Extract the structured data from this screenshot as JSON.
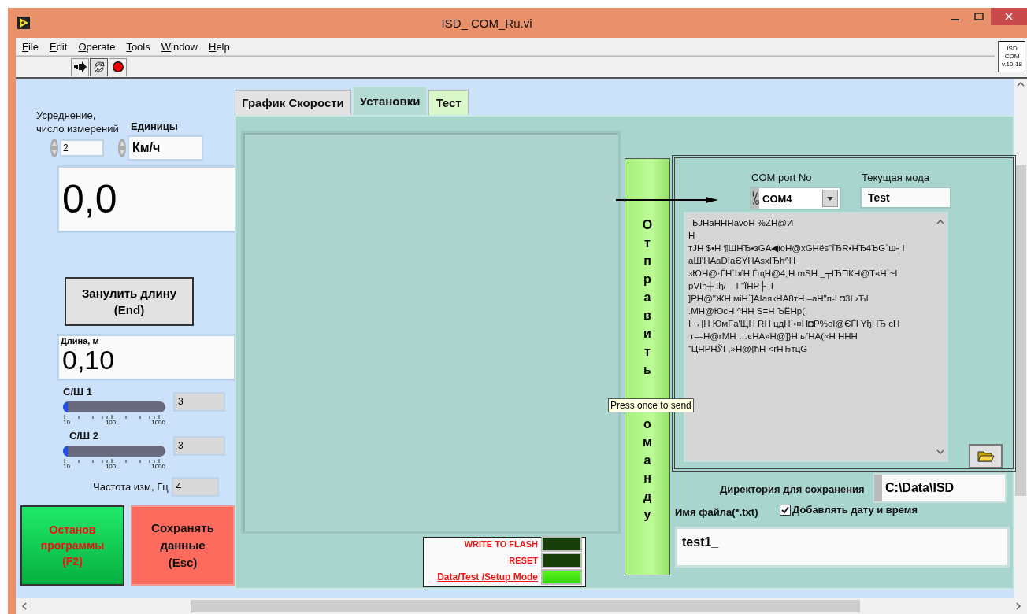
{
  "window": {
    "title": "ISD_ COM_Ru.vi"
  },
  "menu": [
    "File",
    "Edit",
    "Operate",
    "Tools",
    "Window",
    "Help"
  ],
  "vi_icon": {
    "lines": [
      "ISD",
      "COM",
      "v.10-18"
    ]
  },
  "left_panel": {
    "averaging": {
      "label": "Усреднение,\nчисло измерений",
      "value": "2"
    },
    "units": {
      "label": "Единицы",
      "value": "Км/ч"
    },
    "speed": {
      "value": "0,0"
    },
    "zero_button": {
      "label": "Занулить длину\n(End)"
    },
    "length": {
      "label": "Длина, м",
      "value": "0,10"
    },
    "snr": [
      {
        "label": "С/Ш 1",
        "level": 0.02,
        "ticks": [
          "10",
          "100",
          "1000"
        ],
        "value": "3"
      },
      {
        "label": "С/Ш 2",
        "level": 0.02,
        "ticks": [
          "10",
          "100",
          "1000"
        ],
        "value": "3"
      }
    ],
    "frequency": {
      "label": "Частота изм, Гц",
      "value": "4"
    },
    "stop_button": {
      "label": "Останов\nпрограммы\n(F2)"
    },
    "save_button": {
      "label": "Сохранять\nданные\n(Esc)"
    }
  },
  "tabs": [
    {
      "label": "График Скорости",
      "selected": false,
      "color": "#e2e2e2"
    },
    {
      "label": "Установки",
      "selected": true,
      "color": "#b4dbd4"
    },
    {
      "label": "Тест",
      "selected": false,
      "color": "#d9f7c9"
    }
  ],
  "settings": {
    "leds": [
      {
        "label": "WRITE TO FLASH",
        "kind": "plain",
        "on": false
      },
      {
        "label": "RESET",
        "kind": "plain",
        "on": false
      },
      {
        "label": "Data/Test /Setup Mode",
        "kind": "link",
        "on": true
      }
    ],
    "send_button": {
      "label_top": "Отправить",
      "label_bottom": "оманду"
    },
    "tooltip": "Press once to send",
    "com_port": {
      "label": "COM port No",
      "value": "COM4"
    },
    "mode": {
      "label": "Текущая мода",
      "value": "Test"
    },
    "log": [
      " ЪJHaHHHavoH %ZH@И",
      "H",
      "тJH $•H ¶ШHЂ•зGA◀юH@xGHёs\"ЇЂR•HЂ4ЪG`ш┤I",
      "aШ'HAaDIaЄYHAsxIЂh^H",
      "зЮH@·ЃH`bѓH ЃщH@4„H mSH _┬IЂПКH@T«H`~I",
      "pVIђ┼ Iђ/    I \"ЇHP├  I",
      "]PH@\"ЖH мiH`]AIаякHA8тH –aH\"п-I ◘3I ›ЋI",
      ".MH@ЮсH ^HH S=H ЪЁHp(,",
      "I ¬ |H ЮмFa'ЩH RH цдH`•¤H◘P%оI@ЄЃI YђHЂ cH",
      " г—H@rMH …єHA»H@]}H ьѓHA(«H HHH",
      "“ЦHPHЎI ,»H@{ћH <rHЂтцG"
    ],
    "directory": {
      "label": "Директория для сохранения",
      "value": "C:\\Data\\ISD"
    },
    "filename": {
      "label": "Имя файла(*.txt)",
      "value": "test1_"
    },
    "add_datetime": {
      "label": "Добавлять дату и время",
      "checked": true
    }
  }
}
